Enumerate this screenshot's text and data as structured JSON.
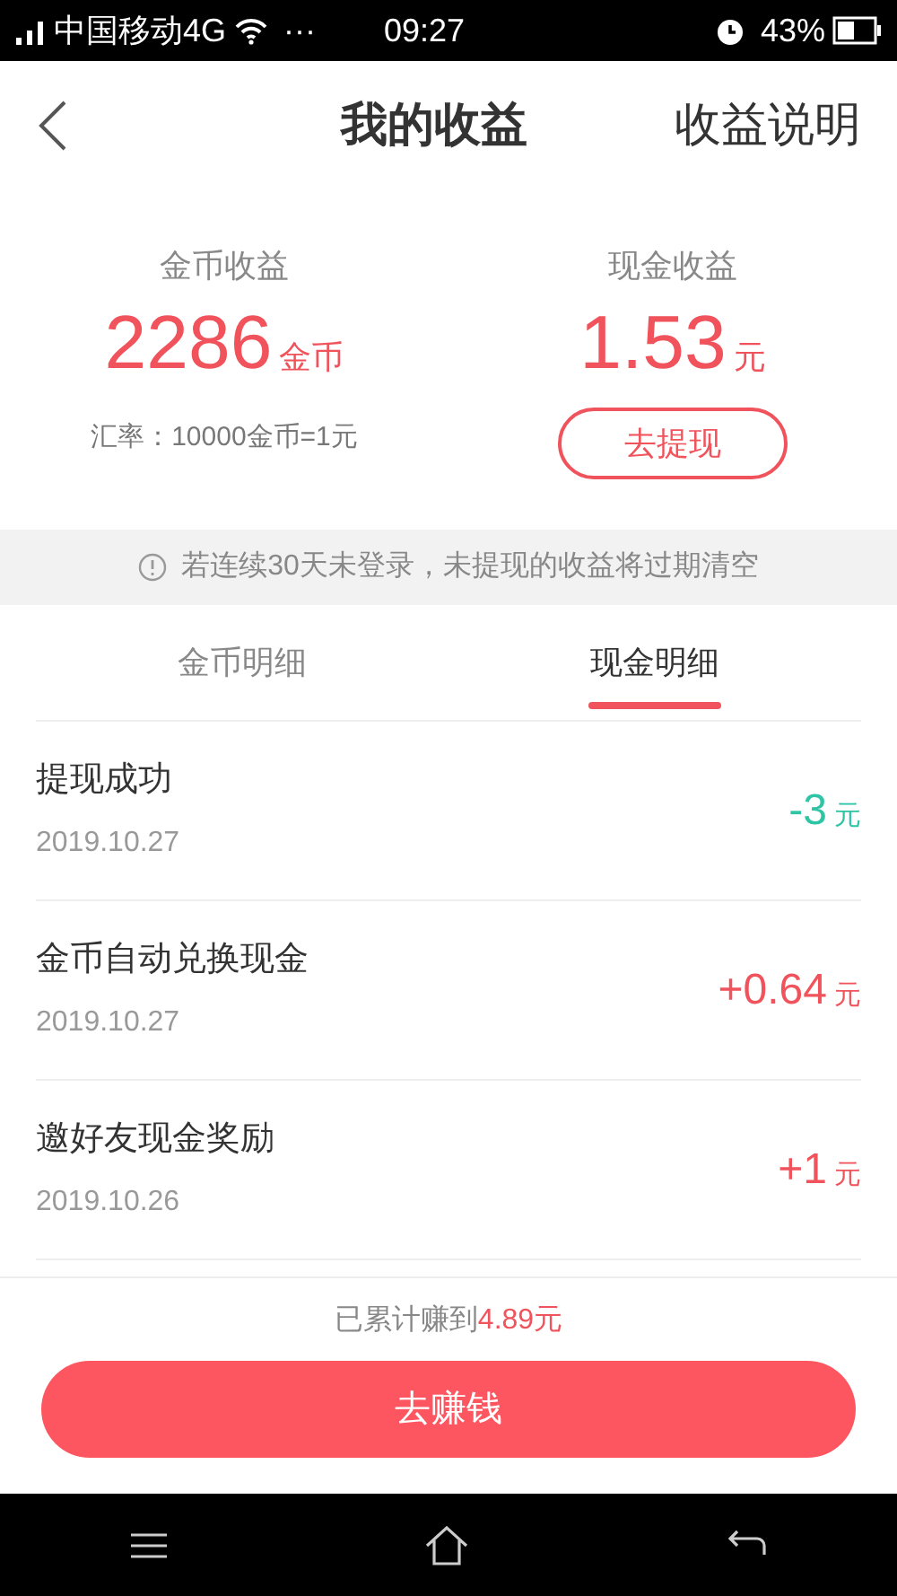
{
  "status_bar": {
    "carrier": "中国移动4G",
    "dots": "···",
    "time": "09:27",
    "battery": "43%"
  },
  "header": {
    "title": "我的收益",
    "action": "收益说明"
  },
  "summary": {
    "coins": {
      "label": "金币收益",
      "value": "2286",
      "unit": "金币",
      "note": "汇率：10000金币=1元"
    },
    "cash": {
      "label": "现金收益",
      "value": "1.53",
      "unit": "元",
      "button": "去提现"
    }
  },
  "notice": "若连续30天未登录，未提现的收益将过期清空",
  "tabs": [
    {
      "label": "金币明细",
      "selected": false
    },
    {
      "label": "现金明细",
      "selected": true
    }
  ],
  "transactions": [
    {
      "title": "提现成功",
      "date": "2019.10.27",
      "amount": "-3",
      "unit": "元",
      "kind": "debit"
    },
    {
      "title": "金币自动兑换现金",
      "date": "2019.10.27",
      "amount": "+0.64",
      "unit": "元",
      "kind": "credit"
    },
    {
      "title": "邀好友现金奖励",
      "date": "2019.10.26",
      "amount": "+1",
      "unit": "元",
      "kind": "credit"
    }
  ],
  "footer": {
    "total_label": "已累计赚到",
    "total_value": "4.89元",
    "button": "去赚钱"
  }
}
